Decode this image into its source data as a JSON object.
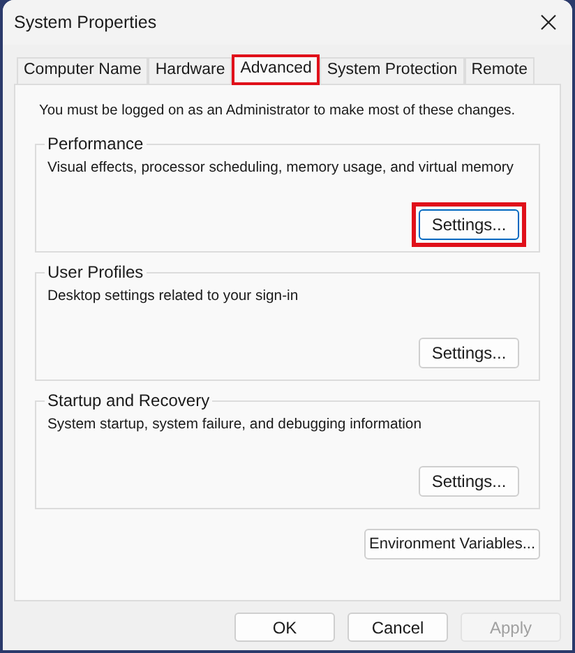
{
  "window": {
    "title": "System Properties"
  },
  "tabs": [
    {
      "label": "Computer Name",
      "selected": false,
      "highlighted": false
    },
    {
      "label": "Hardware",
      "selected": false,
      "highlighted": false
    },
    {
      "label": "Advanced",
      "selected": true,
      "highlighted": true
    },
    {
      "label": "System Protection",
      "selected": false,
      "highlighted": false
    },
    {
      "label": "Remote",
      "selected": false,
      "highlighted": false
    }
  ],
  "notice": "You must be logged on as an Administrator to make most of these changes.",
  "groups": [
    {
      "title": "Performance",
      "description": "Visual effects, processor scheduling, memory usage, and virtual memory",
      "button": {
        "label": "Settings...",
        "focused": true,
        "highlighted": true
      }
    },
    {
      "title": "User Profiles",
      "description": "Desktop settings related to your sign-in",
      "button": {
        "label": "Settings...",
        "focused": false,
        "highlighted": false
      }
    },
    {
      "title": "Startup and Recovery",
      "description": "System startup, system failure, and debugging information",
      "button": {
        "label": "Settings...",
        "focused": false,
        "highlighted": false
      }
    }
  ],
  "environment_button": "Environment Variables...",
  "buttons": [
    {
      "label": "OK",
      "disabled": false
    },
    {
      "label": "Cancel",
      "disabled": false
    },
    {
      "label": "Apply",
      "disabled": true
    }
  ]
}
